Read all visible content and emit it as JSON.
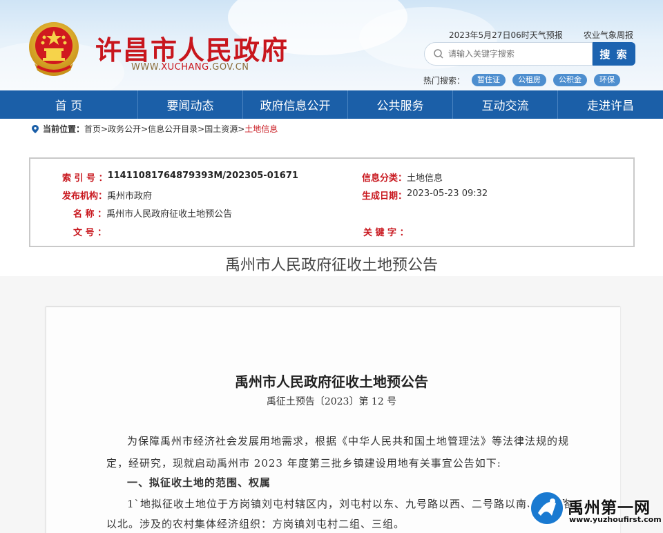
{
  "header": {
    "site_title": "许昌市人民政府",
    "site_url_prefix": "WWW.",
    "site_url_highlight": "XUCHANG",
    "site_url_suffix": ".GOV.CN",
    "weather": "2023年5月27日06时天气预报",
    "agri_weather": "农业气象周报",
    "search_placeholder": "请输入关键字搜索",
    "search_button": "搜 索",
    "hot_label": "热门搜索：",
    "hot_tags": [
      "暂住证",
      "公租房",
      "公积金",
      "环保"
    ]
  },
  "nav": [
    "首 页",
    "要闻动态",
    "政府信息公开",
    "公共服务",
    "互动交流",
    "走进许昌"
  ],
  "breadcrumb": {
    "label": "当前位置：",
    "items": [
      "首页>",
      "政务公开>",
      "信息公开目录>",
      "国土资源>"
    ],
    "current": "土地信息"
  },
  "info": {
    "index_label": "索 引 号 ：",
    "index_value": "11411081764879393M/202305-01671",
    "category_label": "信息分类：",
    "category_value": "土地信息",
    "issuer_label": "发布机构：",
    "issuer_value": "禹州市政府",
    "date_label": "生成日期：",
    "date_value": "2023-05-23 09:32",
    "name_label": "名 称 ：",
    "name_value": "禹州市人民政府征收土地预公告",
    "docno_label": "文 号 ：",
    "keyword_label": "关 键 字 ："
  },
  "page_title": "禹州市人民政府征收土地预公告",
  "document": {
    "title": "禹州市人民政府征收土地预公告",
    "number": "禹征土预告〔2023〕第 12 号",
    "para1_line1": "为保障禹州市经济社会发展用地需求，根据《中华人民共和国土地管理法》等法律法规的规",
    "para1_line2": "定，经研究，现就启动禹州市 2023 年度第三批乡镇建设用地有关事宜公告如下:",
    "section1": "一、拟征收土地的范围、权属",
    "para2_line1": "1ˋ地拟征收土地位于方岗镇刘屯村辖区内，刘屯村以东、九号路以西、二号路以南、三号路",
    "para2_line2": "以北。涉及的农村集体经济组织：方岗镇刘屯村二组、三组。"
  },
  "watermark": {
    "text": "禹州第一网",
    "url": "www.yuzhoufirst.com"
  },
  "colors": {
    "brand_red": "#c8161d",
    "nav_blue": "#1b5fa8",
    "search_blue": "#1c63b0"
  }
}
